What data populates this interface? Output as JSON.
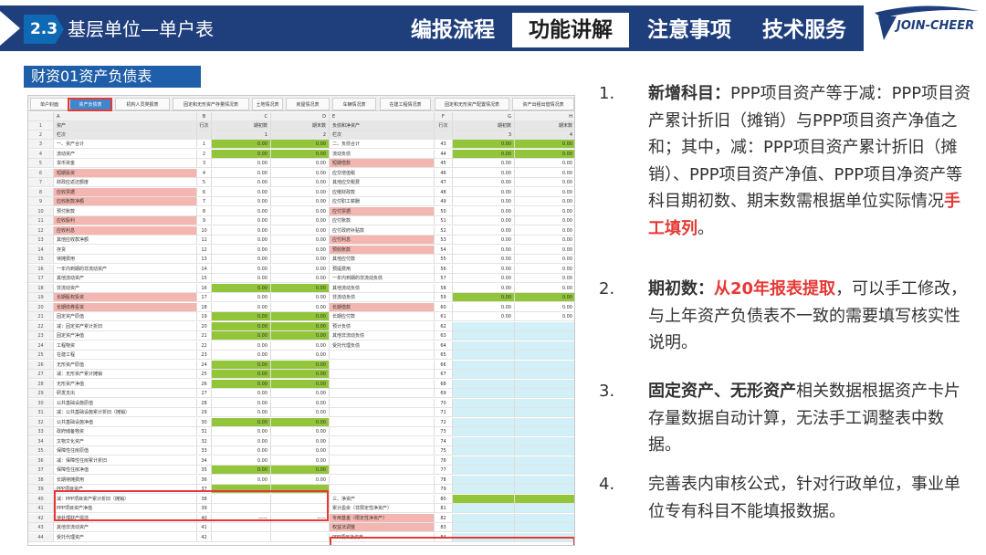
{
  "header": {
    "section_number": "2.3",
    "section_title": "基层单位—单户表",
    "nav_tabs": [
      {
        "label": "编报流程",
        "active": false
      },
      {
        "label": "功能讲解",
        "active": true
      },
      {
        "label": "注意事项",
        "active": false
      },
      {
        "label": "技术服务",
        "active": false
      }
    ],
    "logo_text": "JOIN-CHEER"
  },
  "subtitle": "财资01资产负债表",
  "sheet": {
    "tabs": [
      "单户封面",
      "资产负债表",
      "机构人员类报表",
      "固定和无形资产存量情况表",
      "土地情况表",
      "房屋情况表",
      "车辆情况表",
      "在建工程情况表",
      "固定和无形资产配置情况表",
      "资产出租出借情况表"
    ],
    "active_tab": "资产负债表",
    "col_letters": [
      "A",
      "B",
      "C",
      "D",
      "E",
      "F",
      "G",
      "H"
    ],
    "header_row": {
      "a": "资产",
      "b": "行次",
      "c": "期初数",
      "d": "期末数",
      "e": "负债和净资产",
      "f": "行次",
      "g": "期初数",
      "h": "期末数"
    },
    "index_row": {
      "a": "栏次",
      "b": "",
      "c": "1",
      "d": "2",
      "e": "栏次",
      "f": "",
      "g": "3",
      "h": "4"
    },
    "rows": [
      {
        "rn": "3",
        "a": "一、资产合计",
        "ac": "",
        "b": "1",
        "cc": "g",
        "c": "0.00",
        "dc": "g",
        "d": "0.00",
        "e": "二、负债合计",
        "ec": "",
        "f": "43",
        "gc": "g",
        "g": "0.00",
        "hc": "g",
        "h": "0.00"
      },
      {
        "rn": "4",
        "a": "流动资产",
        "ac": "",
        "b": "2",
        "cc": "g",
        "c": "0.00",
        "dc": "g",
        "d": "0.00",
        "e": "流动负债",
        "ec": "",
        "f": "44",
        "gc": "g",
        "g": "0.00",
        "hc": "g",
        "h": "0.00"
      },
      {
        "rn": "5",
        "a": "货币资金",
        "ac": "",
        "b": "3",
        "cc": "",
        "c": "0.00",
        "dc": "",
        "d": "0.00",
        "e": "短期借款",
        "ec": "r",
        "f": "45",
        "gc": "",
        "g": "0.00",
        "hc": "",
        "h": "0.00"
      },
      {
        "rn": "6",
        "a": "短期投资",
        "ac": "r",
        "b": "4",
        "cc": "",
        "c": "0.00",
        "dc": "",
        "d": "0.00",
        "e": "应交增值税",
        "ec": "",
        "f": "46",
        "gc": "",
        "g": "0.00",
        "hc": "",
        "h": "0.00"
      },
      {
        "rn": "7",
        "a": "财政应返还额度",
        "ac": "",
        "b": "5",
        "cc": "",
        "c": "0.00",
        "dc": "",
        "d": "0.00",
        "e": "其他应交税费",
        "ec": "",
        "f": "47",
        "gc": "",
        "g": "0.00",
        "hc": "",
        "h": "0.00"
      },
      {
        "rn": "8",
        "a": "应收票据",
        "ac": "r",
        "b": "6",
        "cc": "",
        "c": "0.00",
        "dc": "",
        "d": "0.00",
        "e": "应缴财政款",
        "ec": "",
        "f": "48",
        "gc": "",
        "g": "0.00",
        "hc": "",
        "h": "0.00"
      },
      {
        "rn": "9",
        "a": "应收账款净额",
        "ac": "r",
        "b": "7",
        "cc": "",
        "c": "0.00",
        "dc": "",
        "d": "0.00",
        "e": "应付职工薪酬",
        "ec": "",
        "f": "49",
        "gc": "",
        "g": "0.00",
        "hc": "",
        "h": "0.00"
      },
      {
        "rn": "10",
        "a": "预付账款",
        "ac": "",
        "b": "8",
        "cc": "",
        "c": "0.00",
        "dc": "",
        "d": "0.00",
        "e": "应付票据",
        "ec": "r",
        "f": "50",
        "gc": "",
        "g": "0.00",
        "hc": "",
        "h": "0.00"
      },
      {
        "rn": "11",
        "a": "应收股利",
        "ac": "r",
        "b": "9",
        "cc": "",
        "c": "0.00",
        "dc": "",
        "d": "0.00",
        "e": "应付账款",
        "ec": "",
        "f": "51",
        "gc": "",
        "g": "0.00",
        "hc": "",
        "h": "0.00"
      },
      {
        "rn": "12",
        "a": "应收利息",
        "ac": "r",
        "b": "10",
        "cc": "",
        "c": "0.00",
        "dc": "",
        "d": "0.00",
        "e": "应付政府补贴款",
        "ec": "",
        "f": "52",
        "gc": "",
        "g": "0.00",
        "hc": "",
        "h": "0.00"
      },
      {
        "rn": "13",
        "a": "其他应收款净额",
        "ac": "",
        "b": "11",
        "cc": "",
        "c": "0.00",
        "dc": "",
        "d": "0.00",
        "e": "应付利息",
        "ec": "r",
        "f": "53",
        "gc": "",
        "g": "0.00",
        "hc": "",
        "h": "0.00"
      },
      {
        "rn": "14",
        "a": "存货",
        "ac": "",
        "b": "12",
        "cc": "",
        "c": "0.00",
        "dc": "",
        "d": "0.00",
        "e": "预收账款",
        "ec": "r",
        "f": "54",
        "gc": "",
        "g": "0.00",
        "hc": "",
        "h": "0.00"
      },
      {
        "rn": "15",
        "a": "待摊费用",
        "ac": "",
        "b": "13",
        "cc": "",
        "c": "0.00",
        "dc": "",
        "d": "0.00",
        "e": "其他应付款",
        "ec": "",
        "f": "55",
        "gc": "",
        "g": "0.00",
        "hc": "",
        "h": "0.00"
      },
      {
        "rn": "16",
        "a": "一年内到期的非流动资产",
        "ac": "",
        "b": "14",
        "cc": "",
        "c": "0.00",
        "dc": "",
        "d": "0.00",
        "e": "预提费用",
        "ec": "",
        "f": "56",
        "gc": "",
        "g": "0.00",
        "hc": "",
        "h": "0.00"
      },
      {
        "rn": "17",
        "a": "其他流动资产",
        "ac": "",
        "b": "15",
        "cc": "",
        "c": "0.00",
        "dc": "",
        "d": "0.00",
        "e": "一年内到期的非流动负债",
        "ec": "",
        "f": "57",
        "gc": "",
        "g": "0.00",
        "hc": "",
        "h": "0.00"
      },
      {
        "rn": "18",
        "a": "非流动资产",
        "ac": "",
        "b": "16",
        "cc": "g",
        "c": "0.00",
        "dc": "g",
        "d": "0.00",
        "e": "其他流动负债",
        "ec": "",
        "f": "58",
        "gc": "",
        "g": "0.00",
        "hc": "",
        "h": "0.00"
      },
      {
        "rn": "19",
        "a": "长期股权投资",
        "ac": "r",
        "b": "17",
        "cc": "",
        "c": "0.00",
        "dc": "",
        "d": "0.00",
        "e": "非流动负债",
        "ec": "",
        "f": "59",
        "gc": "g",
        "g": "0.00",
        "hc": "g",
        "h": "0.00"
      },
      {
        "rn": "20",
        "a": "长期债券投资",
        "ac": "r",
        "b": "18",
        "cc": "",
        "c": "0.00",
        "dc": "",
        "d": "0.00",
        "e": "长期借款",
        "ec": "r",
        "f": "60",
        "gc": "",
        "g": "0.00",
        "hc": "",
        "h": "0.00"
      },
      {
        "rn": "21",
        "a": "固定资产原值",
        "ac": "",
        "b": "19",
        "cc": "g",
        "c": "0.00",
        "dc": "g",
        "d": "0.00",
        "e": "长期应付款",
        "ec": "",
        "f": "61",
        "gc": "",
        "g": "0.00",
        "hc": "",
        "h": "0.00"
      },
      {
        "rn": "22",
        "a": "减：固定资产累计折旧",
        "ac": "",
        "b": "20",
        "cc": "g",
        "c": "0.00",
        "dc": "g",
        "d": "0.00",
        "e": "预计负债",
        "ec": "",
        "f": "62",
        "gc": "c",
        "g": "",
        "hc": "c",
        "h": ""
      },
      {
        "rn": "23",
        "a": "固定资产净值",
        "ac": "",
        "b": "21",
        "cc": "g",
        "c": "0.00",
        "dc": "g",
        "d": "0.00",
        "e": "其他非流动负债",
        "ec": "",
        "f": "63",
        "gc": "c",
        "g": "",
        "hc": "c",
        "h": ""
      },
      {
        "rn": "24",
        "a": "工程物资",
        "ac": "",
        "b": "22",
        "cc": "",
        "c": "0.00",
        "dc": "",
        "d": "0.00",
        "e": "受托代理负债",
        "ec": "",
        "f": "64",
        "gc": "c",
        "g": "",
        "hc": "c",
        "h": ""
      },
      {
        "rn": "25",
        "a": "在建工程",
        "ac": "",
        "b": "23",
        "cc": "",
        "c": "0.00",
        "dc": "",
        "d": "0.00",
        "e": "",
        "ec": "",
        "f": "65",
        "gc": "c",
        "g": "",
        "hc": "c",
        "h": ""
      },
      {
        "rn": "26",
        "a": "无形资产原值",
        "ac": "",
        "b": "24",
        "cc": "g",
        "c": "0.00",
        "dc": "g",
        "d": "0.00",
        "e": "",
        "ec": "",
        "f": "66",
        "gc": "c",
        "g": "",
        "hc": "c",
        "h": ""
      },
      {
        "rn": "27",
        "a": "减：无形资产累计摊销",
        "ac": "",
        "b": "25",
        "cc": "g",
        "c": "0.00",
        "dc": "g",
        "d": "0.00",
        "e": "",
        "ec": "",
        "f": "67",
        "gc": "c",
        "g": "",
        "hc": "c",
        "h": ""
      },
      {
        "rn": "28",
        "a": "无形资产净值",
        "ac": "",
        "b": "26",
        "cc": "g",
        "c": "0.00",
        "dc": "g",
        "d": "0.00",
        "e": "",
        "ec": "",
        "f": "68",
        "gc": "c",
        "g": "",
        "hc": "c",
        "h": ""
      },
      {
        "rn": "29",
        "a": "研发支出",
        "ac": "",
        "b": "27",
        "cc": "",
        "c": "0.00",
        "dc": "",
        "d": "0.00",
        "e": "",
        "ec": "",
        "f": "69",
        "gc": "c",
        "g": "",
        "hc": "c",
        "h": ""
      },
      {
        "rn": "30",
        "a": "公共基础设施原值",
        "ac": "",
        "b": "28",
        "cc": "",
        "c": "0.00",
        "dc": "",
        "d": "0.00",
        "e": "",
        "ec": "",
        "f": "70",
        "gc": "c",
        "g": "",
        "hc": "c",
        "h": ""
      },
      {
        "rn": "31",
        "a": "减：公共基础设施累计折旧（摊销）",
        "ac": "",
        "b": "29",
        "cc": "",
        "c": "0.00",
        "dc": "",
        "d": "0.00",
        "e": "",
        "ec": "",
        "f": "71",
        "gc": "c",
        "g": "",
        "hc": "c",
        "h": ""
      },
      {
        "rn": "32",
        "a": "公共基础设施净值",
        "ac": "",
        "b": "30",
        "cc": "g",
        "c": "0.00",
        "dc": "g",
        "d": "0.00",
        "e": "",
        "ec": "",
        "f": "72",
        "gc": "c",
        "g": "",
        "hc": "c",
        "h": ""
      },
      {
        "rn": "33",
        "a": "政府储备物资",
        "ac": "",
        "b": "31",
        "cc": "",
        "c": "0.00",
        "dc": "",
        "d": "0.00",
        "e": "",
        "ec": "",
        "f": "73",
        "gc": "c",
        "g": "",
        "hc": "c",
        "h": ""
      },
      {
        "rn": "34",
        "a": "文物文化资产",
        "ac": "",
        "b": "32",
        "cc": "",
        "c": "0.00",
        "dc": "",
        "d": "0.00",
        "e": "",
        "ec": "",
        "f": "74",
        "gc": "c",
        "g": "",
        "hc": "c",
        "h": ""
      },
      {
        "rn": "35",
        "a": "保障性住房原值",
        "ac": "",
        "b": "33",
        "cc": "",
        "c": "0.00",
        "dc": "",
        "d": "0.00",
        "e": "",
        "ec": "",
        "f": "75",
        "gc": "c",
        "g": "",
        "hc": "c",
        "h": ""
      },
      {
        "rn": "36",
        "a": "减：保障性住房累计折旧",
        "ac": "",
        "b": "34",
        "cc": "",
        "c": "0.00",
        "dc": "",
        "d": "0.00",
        "e": "",
        "ec": "",
        "f": "76",
        "gc": "c",
        "g": "",
        "hc": "c",
        "h": ""
      },
      {
        "rn": "37",
        "a": "保障性住房净值",
        "ac": "",
        "b": "35",
        "cc": "g",
        "c": "0.00",
        "dc": "g",
        "d": "0.00",
        "e": "",
        "ec": "",
        "f": "77",
        "gc": "c",
        "g": "",
        "hc": "c",
        "h": ""
      },
      {
        "rn": "38",
        "a": "长期待摊费用",
        "ac": "",
        "b": "36",
        "cc": "",
        "c": "0.00",
        "dc": "",
        "d": "0.00",
        "e": "",
        "ec": "",
        "f": "78",
        "gc": "c",
        "g": "",
        "hc": "c",
        "h": ""
      },
      {
        "rn": "39",
        "a": "PPP项目资产",
        "ac": "",
        "b": "37",
        "cc": "g",
        "c": "",
        "dc": "g",
        "d": "",
        "e": "",
        "ec": "",
        "f": "79",
        "gc": "c",
        "g": "",
        "hc": "c",
        "h": ""
      },
      {
        "rn": "40",
        "a": "减：PPP项目资产累计折旧（摊销）",
        "ac": "",
        "b": "38",
        "cc": "",
        "c": "",
        "dc": "",
        "d": "",
        "e": "三、净资产",
        "ec": "",
        "f": "80",
        "gc": "g",
        "g": "",
        "hc": "g",
        "h": ""
      },
      {
        "rn": "41",
        "a": "PPP项目资产净值",
        "ac": "",
        "b": "39",
        "cc": "",
        "c": "",
        "dc": "",
        "d": "",
        "e": "累计盈余（非限定性净资产）",
        "ec": "",
        "f": "81",
        "gc": "c",
        "g": "",
        "hc": "c",
        "h": ""
      },
      {
        "rn": "42",
        "a": "待处理财产损溢",
        "ac": "",
        "b": "40",
        "cc": "",
        "c": "——",
        "dc": "",
        "d": "——",
        "e": "专用基金（限定性净资产）",
        "ec": "r",
        "f": "82",
        "gc": "c",
        "g": "",
        "hc": "c",
        "h": ""
      },
      {
        "rn": "43",
        "a": "其他非流动资产",
        "ac": "",
        "b": "41",
        "cc": "",
        "c": "",
        "dc": "",
        "d": "",
        "e": "权益法调整",
        "ec": "r",
        "f": "83",
        "gc": "c",
        "g": "",
        "hc": "c",
        "h": ""
      },
      {
        "rn": "44",
        "a": "受托代理资产",
        "ac": "",
        "b": "42",
        "cc": "",
        "c": "",
        "dc": "",
        "d": "",
        "e": "PPP项目净资产",
        "ec": "",
        "f": "84",
        "gc": "c",
        "g": "",
        "hc": "c",
        "h": ""
      }
    ]
  },
  "notes": [
    {
      "num": "1.",
      "parts": [
        {
          "text": "新增科目：",
          "style": "b"
        },
        {
          "text": "PPP项目资产等于减：PPP项目资产累计折旧（摊销）与PPP项目资产净值之和；其中，减：PPP项目资产累计折旧（摊销）、PPP项目资产净值、PPP项目净资产等科目期初数、期末数需根据单位实际情况",
          "style": ""
        },
        {
          "text": "手工填列",
          "style": "red"
        },
        {
          "text": "。",
          "style": ""
        }
      ]
    },
    {
      "num": "2.",
      "parts": [
        {
          "text": "期初数：",
          "style": "b"
        },
        {
          "text": "从20年报表提取",
          "style": "red"
        },
        {
          "text": "，可以手工修改，与上年资产负债表不一致的需要填写核实性说明。",
          "style": ""
        }
      ]
    },
    {
      "num": "3.",
      "parts": [
        {
          "text": "固定资产、无形资产",
          "style": "b"
        },
        {
          "text": "相关数据根据资产卡片存量数据自动计算，无法手工调整表中数据。",
          "style": ""
        }
      ]
    },
    {
      "num": "4.",
      "parts": [
        {
          "text": "完善表内审核公式，针对行政单位，事业单位专有科目不能填报数据。",
          "style": ""
        }
      ]
    }
  ]
}
